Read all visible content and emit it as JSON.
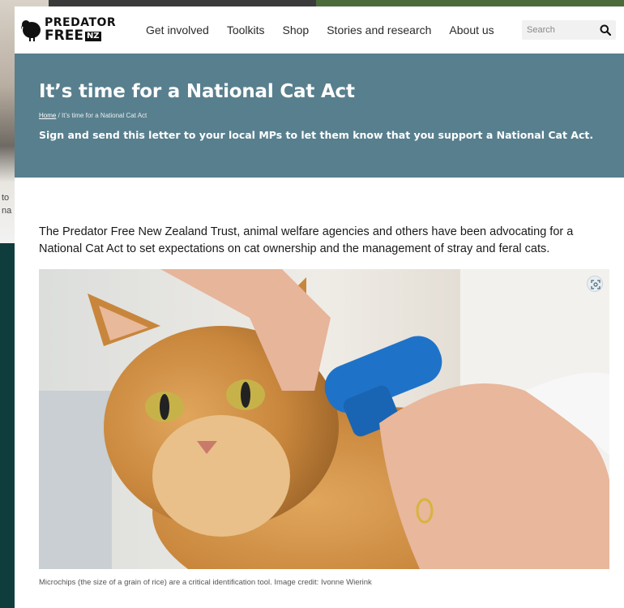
{
  "background": {
    "fragment_1": "to",
    "fragment_2": "na"
  },
  "logo": {
    "line1": "PREDATOR",
    "line2": "FREE",
    "badge": "NZ"
  },
  "nav": {
    "items": [
      {
        "label": "Get involved"
      },
      {
        "label": "Toolkits"
      },
      {
        "label": "Shop"
      },
      {
        "label": "Stories and research"
      },
      {
        "label": "About us"
      }
    ],
    "search": {
      "placeholder": "Search"
    }
  },
  "hero": {
    "title": "It’s time for a National Cat Act",
    "breadcrumb": {
      "home": "Home",
      "separator": "/",
      "current": "It’s time for a National Cat Act"
    },
    "subtitle": "Sign and send this letter to your local MPs to let them know that you support a National Cat Act."
  },
  "content": {
    "intro": "The Predator Free New Zealand Trust, animal welfare agencies and others have been advocating for a National Cat Act to set expectations on cat ownership and the management of stray and feral cats.",
    "caption": "Microchips (the size of a grain of rice) are a critical identification tool. Image credit: Ivonne Wierink"
  },
  "colors": {
    "hero_bg": "#587f8d",
    "background": "#0f3d3e"
  },
  "icons": {
    "logo": "kiwi-bird-icon",
    "search": "search-icon",
    "zoom": "expand-icon"
  }
}
